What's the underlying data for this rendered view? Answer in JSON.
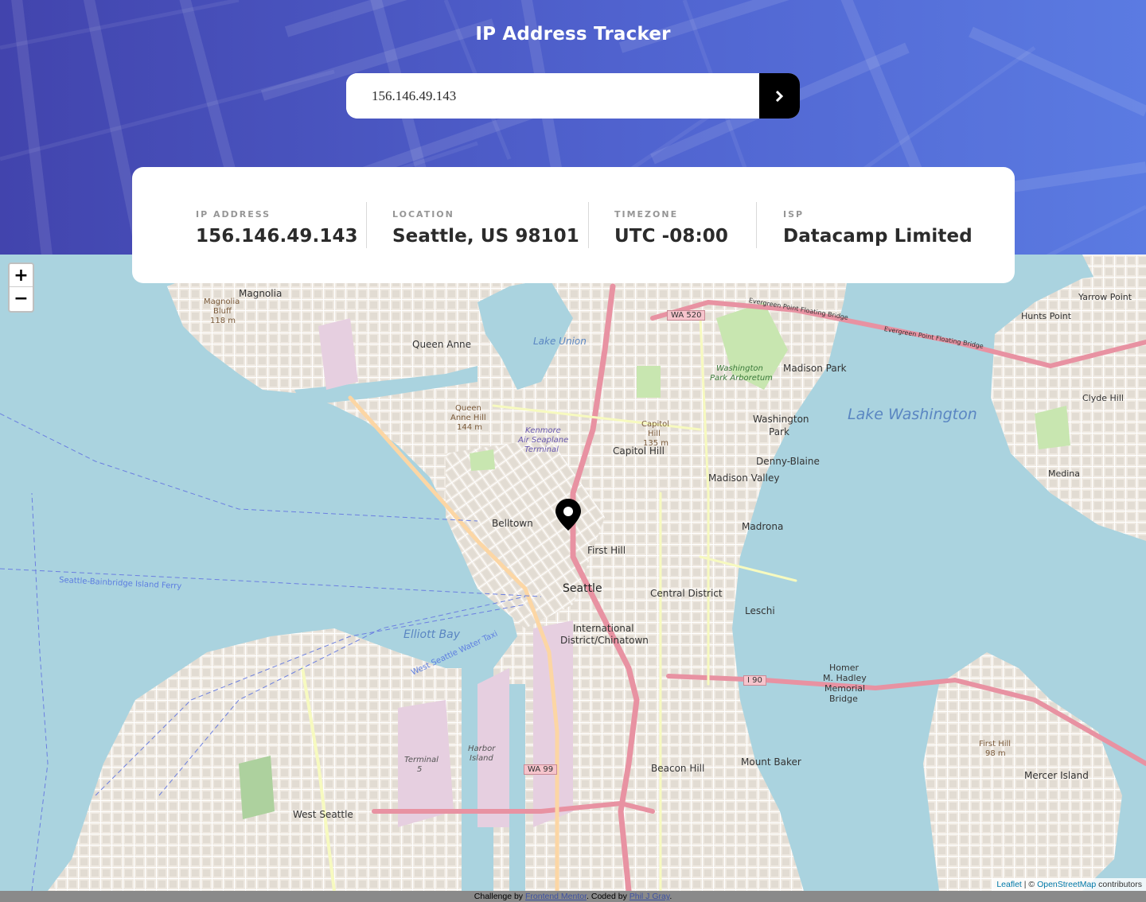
{
  "header": {
    "title": "IP Address Tracker",
    "search": {
      "value": "156.146.49.143",
      "submit_icon": "chevron-right-icon"
    }
  },
  "info": [
    {
      "label": "IP ADDRESS",
      "value": "156.146.49.143"
    },
    {
      "label": "LOCATION",
      "value": "Seattle, US 98101"
    },
    {
      "label": "TIMEZONE",
      "value": "UTC -08:00"
    },
    {
      "label": "ISP",
      "value": "Datacamp Limited"
    }
  ],
  "map": {
    "zoom_in": "+",
    "zoom_out": "−",
    "marker_icon": "location-pin-icon",
    "labels": {
      "magnolia": "Magnolia",
      "magnolia_bluff": "Magnolia",
      "magnolia_bluff2": "Bluff",
      "magnolia_bluff3": "118 m",
      "queen_anne": "Queen Anne",
      "queen_anne_hill": "Queen",
      "queen_anne_hill2": "Anne Hill",
      "queen_anne_hill3": "144 m",
      "lake_union": "Lake Union",
      "madison_park": "Madison Park",
      "lake_washington": "Lake Washington",
      "washington_park": "Washington",
      "washington_park2": "Park",
      "washington_arboretum": "Washington",
      "washington_arboretum2": "Park Arboretum",
      "capitol_hill": "Capitol Hill",
      "capitol_hill_peak": "Capitol",
      "capitol_hill_peak2": "Hill",
      "capitol_hill_peak3": "135 m",
      "denny_blaine": "Denny-Blaine",
      "madison_valley": "Madison Valley",
      "madrona": "Madrona",
      "belltown": "Belltown",
      "first_hill": "First Hill",
      "seattle": "Seattle",
      "central_district": "Central District",
      "leschi": "Leschi",
      "international": "International",
      "international2": "District/Chinatown",
      "elliott_bay": "Elliott Bay",
      "west_seattle": "West Seattle",
      "mount_baker": "Mount Baker",
      "beacon_hill": "Beacon Hill",
      "homer": "Homer",
      "homer2": "M. Hadley",
      "homer3": "Memorial",
      "homer4": "Bridge",
      "mercer_island": "Mercer Island",
      "first_hill_mercer": "First Hill",
      "first_hill_mercer2": "98 m",
      "yarrow_point": "Yarrow Point",
      "hunts_point": "Hunts Point",
      "clyde_hill": "Clyde Hill",
      "medina": "Medina",
      "ferry_bainbridge": "Seattle-Bainbridge Island Ferry",
      "water_taxi": "West Seattle Water Taxi",
      "kenmore": "Kenmore",
      "kenmore2": "Air Seaplane",
      "kenmore3": "Terminal",
      "harbor_island": "Harbor",
      "harbor_island2": "Island",
      "terminal5": "Terminal",
      "terminal5b": "5",
      "wa520": "WA 520",
      "wa99": "WA 99",
      "i90": "I 90",
      "evergreen": "Evergreen Point Floating Bridge"
    }
  },
  "attribution": {
    "leaflet": "Leaflet",
    "sep": " | © ",
    "osm": "OpenStreetMap",
    "contrib": " contributors"
  },
  "footer": {
    "prefix": "Challenge by ",
    "link1": "Frontend Mentor",
    "middle": ". Coded by ",
    "link2": "Phil J Gray",
    "suffix": "."
  }
}
